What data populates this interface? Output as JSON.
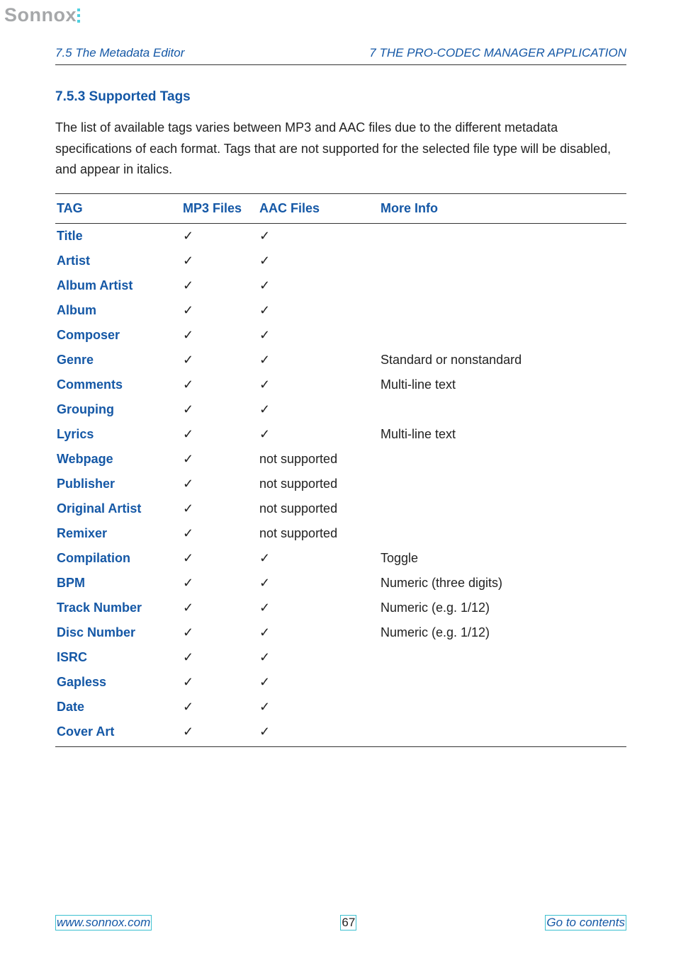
{
  "brand": "Sonnox",
  "running_head": {
    "left": "7.5   The Metadata Editor",
    "right": "7   THE PRO-CODEC MANAGER APPLICATION"
  },
  "section": {
    "number_title": "7.5.3   Supported Tags",
    "paragraph": "The list of available tags varies between MP3 and AAC files due to the different metadata specifications of each format. Tags that are not supported for the selected file type will be disabled, and appear in italics."
  },
  "table": {
    "headers": {
      "tag": "TAG",
      "mp3": "MP3 Files",
      "aac": "AAC Files",
      "info": "More Info"
    },
    "check": "✓",
    "not_supported": "not supported",
    "rows": [
      {
        "tag": "Title",
        "mp3": "check",
        "aac": "check",
        "info": ""
      },
      {
        "tag": "Artist",
        "mp3": "check",
        "aac": "check",
        "info": ""
      },
      {
        "tag": "Album Artist",
        "mp3": "check",
        "aac": "check",
        "info": ""
      },
      {
        "tag": "Album",
        "mp3": "check",
        "aac": "check",
        "info": ""
      },
      {
        "tag": "Composer",
        "mp3": "check",
        "aac": "check",
        "info": ""
      },
      {
        "tag": "Genre",
        "mp3": "check",
        "aac": "check",
        "info": "Standard or nonstandard"
      },
      {
        "tag": "Comments",
        "mp3": "check",
        "aac": "check",
        "info": "Multi-line text"
      },
      {
        "tag": "Grouping",
        "mp3": "check",
        "aac": "check",
        "info": ""
      },
      {
        "tag": "Lyrics",
        "mp3": "check",
        "aac": "check",
        "info": "Multi-line text"
      },
      {
        "tag": "Webpage",
        "mp3": "check",
        "aac": "not_supported",
        "info": ""
      },
      {
        "tag": "Publisher",
        "mp3": "check",
        "aac": "not_supported",
        "info": ""
      },
      {
        "tag": "Original Artist",
        "mp3": "check",
        "aac": "not_supported",
        "info": ""
      },
      {
        "tag": "Remixer",
        "mp3": "check",
        "aac": "not_supported",
        "info": ""
      },
      {
        "tag": "Compilation",
        "mp3": "check",
        "aac": "check",
        "info": "Toggle"
      },
      {
        "tag": "BPM",
        "mp3": "check",
        "aac": "check",
        "info": "Numeric (three digits)"
      },
      {
        "tag": "Track Number",
        "mp3": "check",
        "aac": "check",
        "info": "Numeric (e.g. 1/12)"
      },
      {
        "tag": "Disc Number",
        "mp3": "check",
        "aac": "check",
        "info": "Numeric (e.g. 1/12)"
      },
      {
        "tag": "ISRC",
        "mp3": "check",
        "aac": "check",
        "info": ""
      },
      {
        "tag": "Gapless",
        "mp3": "check",
        "aac": "check",
        "info": ""
      },
      {
        "tag": "Date",
        "mp3": "check",
        "aac": "check",
        "info": ""
      },
      {
        "tag": "Cover Art",
        "mp3": "check",
        "aac": "check",
        "info": ""
      }
    ]
  },
  "footer": {
    "url": "www.sonnox.com",
    "page": "67",
    "contents": "Go to contents"
  }
}
